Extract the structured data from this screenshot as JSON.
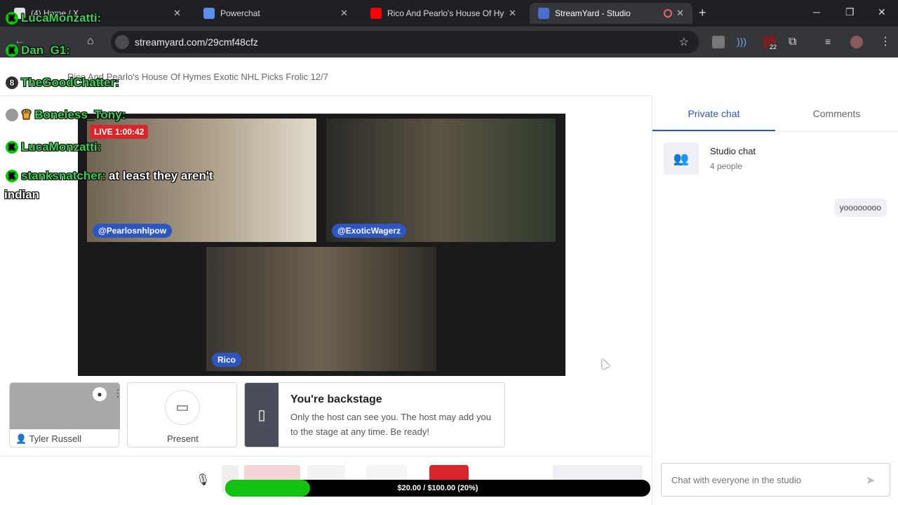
{
  "browser": {
    "tabs": [
      {
        "label": "(4) Home / X",
        "color": "#e2e2e2"
      },
      {
        "label": "Powerchat",
        "color": "#5b8def"
      },
      {
        "label": "Rico And Pearlo's House Of Hymes Exotic",
        "color": "#ff0000"
      },
      {
        "label": "StreamYard - Studio",
        "color": "#4b6fd1"
      }
    ],
    "new_tab": "+",
    "minimize": "─",
    "restore": "❐",
    "close": "✕",
    "url": "streamyard.com/29cmf48cfz",
    "extension_badge": "22"
  },
  "overlay_chat": [
    {
      "user": "LucaMonzatti:",
      "message": ""
    },
    {
      "user": "Dan_G1:",
      "message": ""
    },
    {
      "user": "TheGoodChatter:",
      "message": ""
    },
    {
      "user": "Boneless_Tony:",
      "message": ""
    },
    {
      "user": "LucaMonzatti:",
      "message": ""
    },
    {
      "user": "stanksnatcher:",
      "message": "at least they aren't"
    },
    {
      "user": "",
      "message": "indian"
    }
  ],
  "broadcast": {
    "title": "Rico And Pearlo's House Of Hymes Exotic NHL Picks Frolic 12/7"
  },
  "stage": {
    "live": "LIVE 1:00:42",
    "participants": [
      {
        "name": "@Pearlosnhlpow"
      },
      {
        "name": "@ExoticWagerz"
      },
      {
        "name": "Rico"
      }
    ]
  },
  "backstage": {
    "camera_name": "Tyler Russell",
    "present_label": "Present",
    "title": "You're backstage",
    "text": "Only the host can see you. The host may add you to the stage at any time. Be ready!"
  },
  "progress": {
    "text": "$20.00 / $100.00 (20%)",
    "fraction": 0.2
  },
  "sidebar": {
    "tabs": [
      "Private chat",
      "Comments"
    ],
    "studio_chat_title": "Studio chat",
    "studio_chat_sub": "4 people",
    "message": "yoooooooo",
    "chat_placeholder": "Chat with everyone in the studio"
  }
}
